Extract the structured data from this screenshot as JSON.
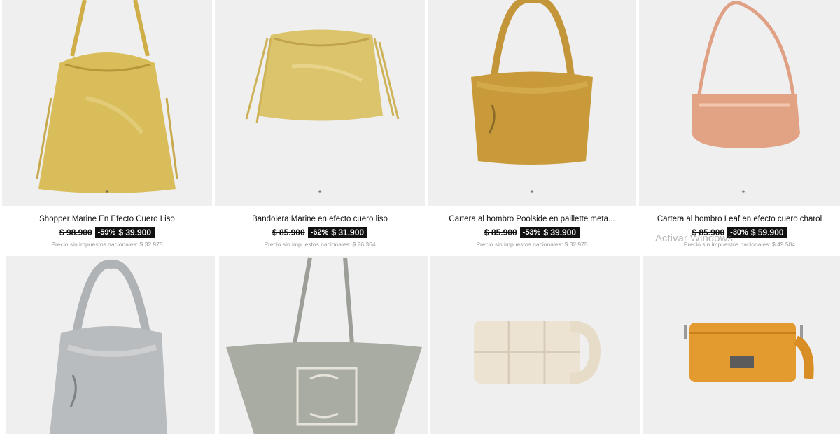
{
  "products": [
    {
      "name": "Shopper Marine En Efecto Cuero Liso",
      "old_price": "$ 98.900",
      "discount": "-59%",
      "price": "$ 39.900",
      "net_price": "Precio sin impuestos nacionales: $ 32.975",
      "color": "#d8bd5a"
    },
    {
      "name": "Bandolera Marine en efecto cuero liso",
      "old_price": "$ 85.900",
      "discount": "-62%",
      "price": "$ 31.900",
      "net_price": "Precio sin impuestos nacionales: $ 26.364",
      "color": "#dcc46c"
    },
    {
      "name": "Cartera al hombro Poolside en paillette meta...",
      "old_price": "$ 85.900",
      "discount": "-53%",
      "price": "$ 39.900",
      "net_price": "Precio sin impuestos nacionales: $ 32.975",
      "color": "#c99a3a"
    },
    {
      "name": "Cartera al hombro Leaf en efecto cuero charol",
      "old_price": "$ 85.900",
      "discount": "-30%",
      "price": "$ 59.900",
      "net_price": "Precio sin impuestos nacionales: $ 49.504",
      "color": "#e2a385"
    },
    {
      "color": "#b9bcbe"
    },
    {
      "color": "#a9aca3"
    },
    {
      "color": "#ece3d2"
    },
    {
      "color": "#e39a2e"
    }
  ],
  "image_dot": "+",
  "watermark": "Activar Windows"
}
